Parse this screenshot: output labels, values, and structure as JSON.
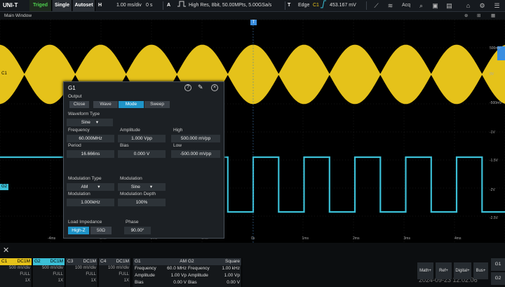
{
  "topbar": {
    "logo": "UNI-T",
    "status": "Triged",
    "single": "Single",
    "autoset": "Autoset",
    "h_label": "H",
    "timebase": "1.00 ms/div",
    "delay": "0 s",
    "a_label": "A",
    "acq_mode": "High Res, 8bit, 50.00MPts, 5.00GSa/s",
    "t_label": "T",
    "trig_type": "Edge",
    "trig_src": "C1",
    "trig_level": "453.167 mV",
    "acq_label": "Acq"
  },
  "window": {
    "title": "Main Window"
  },
  "markers": {
    "c1": "C1",
    "g2": "G2",
    "trig": "T"
  },
  "right_axis": [
    "500mV",
    "0V",
    "-500mV",
    "-1V",
    "-1.5V",
    "-2V",
    "-2.5V"
  ],
  "time_axis": [
    "-4ms",
    "-3ms",
    "-2ms",
    "-1ms",
    "0s",
    "1ms",
    "2ms",
    "3ms",
    "4ms"
  ],
  "dialog": {
    "title": "G1",
    "output_label": "Output",
    "modes": [
      "Close",
      "Wave",
      "Mode",
      "Sweep"
    ],
    "active_mode": "Mode",
    "waveform_type_label": "Waveform Type",
    "waveform_type": "Sine",
    "frequency_label": "Frequency",
    "frequency": "60.000MHz",
    "amplitude_label": "Amplitude",
    "amplitude": "1.000 Vpp",
    "high_label": "High",
    "high": "500.000 mVpp",
    "period_label": "Period",
    "period": "16.666ns",
    "bias_label": "Bias",
    "bias": "0.000 V",
    "low_label": "Low",
    "low": "-500.000 mVpp",
    "mod_type_label": "Modulation Type",
    "mod_type": "AM",
    "modulation_label": "Modulation",
    "modulation": "Sine",
    "mod_freq_label": "Modulation",
    "mod_freq": "1.000kHz",
    "mod_depth_label": "Modulation Depth",
    "mod_depth": "100%",
    "load_label": "Load Impedance",
    "loads": [
      "High-Z",
      "50Ω"
    ],
    "active_load": "High-Z",
    "phase_label": "Phase",
    "phase": "90.00°"
  },
  "channels": [
    {
      "name": "C1",
      "coupling": "DC1M",
      "scale": "500 mV/div",
      "bw": "FULL",
      "probe": "1X",
      "color": "#e5c21a"
    },
    {
      "name": "G2",
      "coupling": "DC1M",
      "scale": "500 mV/div",
      "bw": "FULL",
      "probe": "1X",
      "color": "#3bbfd6"
    },
    {
      "name": "C3",
      "coupling": "DC1M",
      "scale": "100 mV/div",
      "bw": "FULL",
      "probe": "1X",
      "color": "#cccccc"
    },
    {
      "name": "C4",
      "coupling": "DC1M",
      "scale": "100 mV/div",
      "bw": "FULL",
      "probe": "1X",
      "color": "#cccccc"
    }
  ],
  "gen1": {
    "name": "G1",
    "mode": "AM",
    "freq_label": "Frequency",
    "freq": "60.0 MHz",
    "amp_label": "Amplitude",
    "amp": "1.00 Vp",
    "bias_label": "Bias",
    "bias": "0.00 V"
  },
  "gen2": {
    "name": "G2",
    "mode": "Square",
    "freq_label": "Frequency",
    "freq": "1.00 kHz",
    "amp_label": "Amplitude",
    "amp": "1.00 Vp",
    "bias_label": "Bias",
    "bias": "0.00 V"
  },
  "right_buttons": {
    "math": "Math+",
    "ref": "Ref+",
    "digital": "Digital+",
    "bus": "Bus+",
    "g1": "G1",
    "g2": "G2"
  },
  "timestamp": "2024-09-23 12:02:06",
  "colors": {
    "c1": "#e5c21a",
    "g2": "#3bbfd6",
    "accent": "#1f94c8"
  }
}
